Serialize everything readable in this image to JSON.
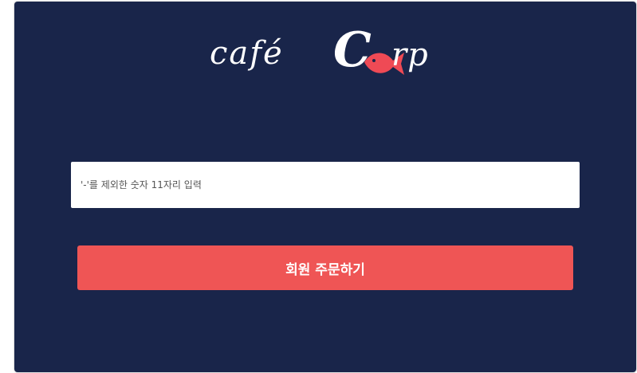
{
  "logo": {
    "cafe_text": "café",
    "c_letter": "C",
    "rp_text": "rp"
  },
  "login": {
    "phone_placeholder": "'-'를 제외한 숫자 11자리 입력",
    "phone_value": "",
    "submit_label": "회원 주문하기"
  },
  "colors": {
    "background": "#19254a",
    "accent": "#ef5555",
    "input_background": "#ffffff"
  },
  "icons": [
    "fish-icon"
  ]
}
